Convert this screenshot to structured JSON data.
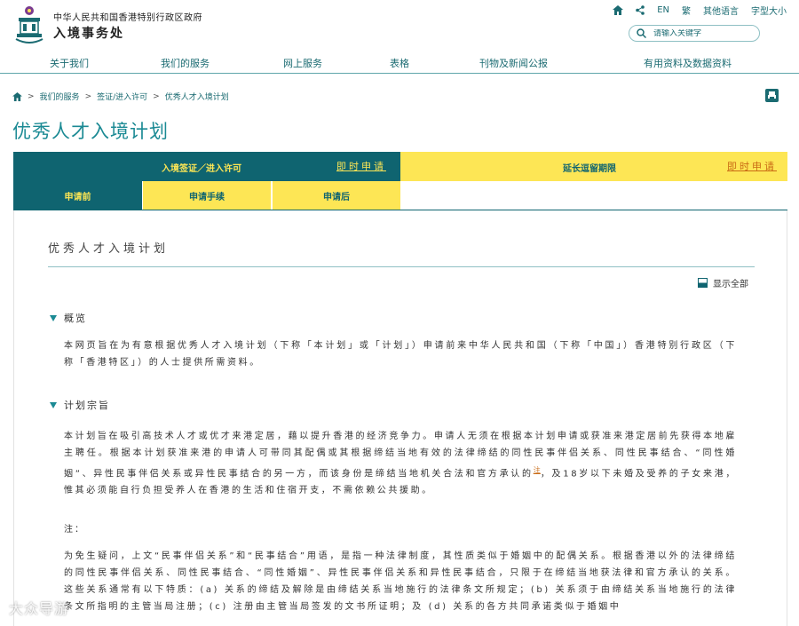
{
  "header": {
    "gov_name": "中华人民共和国香港特别行政区政府",
    "dept_name": "入境事务处",
    "links": [
      "EN",
      "繁",
      "其他语言",
      "字型大小"
    ],
    "search_placeholder": "请输入关键字"
  },
  "nav": [
    "关于我们",
    "我们的服务",
    "网上服务",
    "表格",
    "刊物及新闻公报",
    "有用资料及数据资料"
  ],
  "breadcrumb": [
    "我们的服务",
    "签证/进入许可",
    "优秀人才入境计划"
  ],
  "page_title": "优秀人才入境计划",
  "tabs": {
    "left_label": "入境签证／进入许可",
    "left_apply": "即时申请",
    "right_label": "延长逗留期限",
    "right_apply": "即时申请",
    "sub": [
      "申请前",
      "申请手续",
      "申请后"
    ]
  },
  "content": {
    "title": "优秀人才入境计划",
    "show_all": "显示全部",
    "sections": [
      {
        "heading": "概览",
        "text": "本网页旨在为有意根据优秀人才入境计划（下称「本计划」或「计划」）申请前来中华人民共和国（下称「中国」）香港特别行政区（下称「香港特区」）的人士提供所需资料。"
      },
      {
        "heading": "计划宗旨",
        "text_a": "本计划旨在吸引高技术人才或优才来港定居，藉以提升香港的经济竞争力。申请人无须在根据本计划申请或获准来港定居前先获得本地雇主聘任。根据本计划获准来港的申请人可带同其配偶或其根据缔结当地有效的法律缔结的同性民事伴侣关系、同性民事结合、“同性婚姻”、异性民事伴侣关系或异性民事结合的另一方，而该身份是缔结当地机关合法和官方承认的",
        "footnote": "注",
        "text_b": "，及18岁以下未婚及受养的子女来港，惟其必须能自行负担受养人在香港的生活和住宿开支，不需依赖公共援助。"
      }
    ],
    "note_label": "注：",
    "note_text": "为免生疑问，上文“民事伴侣关系”和“民事结合”用语，是指一种法律制度，其性质类似于婚姻中的配偶关系。根据香港以外的法律缔结的同性民事伴侣关系、同性民事结合、“同性婚姻”、异性民事伴侣关系和异性民事结合，只限于在缔结当地获法律和官方承认的关系。这些关系通常有以下特质：(a) 关系的缔结及解除是由缔结关系当地施行的法律条文所规定；(b) 关系须于由缔结关系当地施行的法律条文所指明的主管当局注册；(c) 注册由主管当局签发的文书所证明；及 (d) 关系的各方共同承诺类似于婚姻中"
  },
  "watermark": "大众导游"
}
